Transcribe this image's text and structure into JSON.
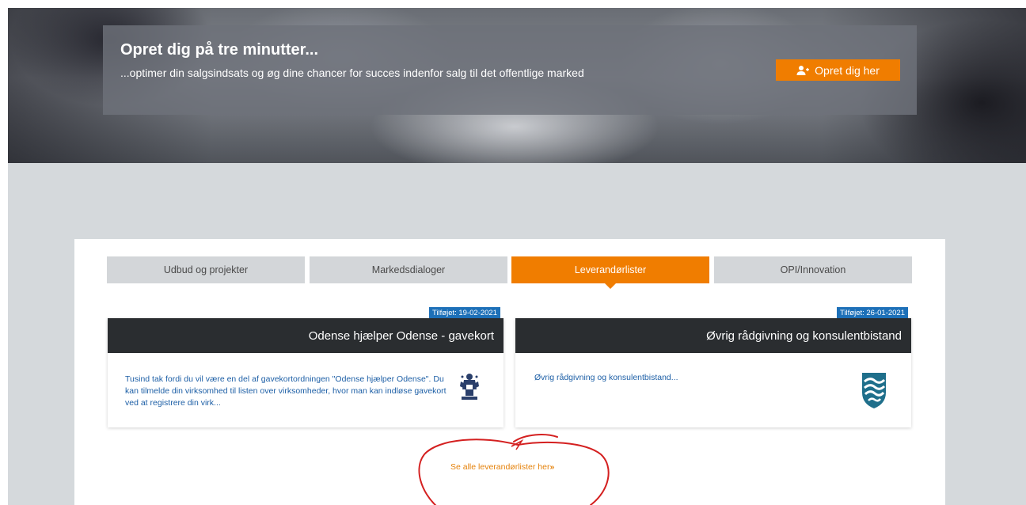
{
  "hero": {
    "title": "Opret dig på tre minutter...",
    "subtitle": "...optimer din salgsindsats og øg dine chancer for succes indenfor salg til det offentlige marked",
    "cta_label": "Opret dig her",
    "cta_icon": "user-plus-icon"
  },
  "tabs": [
    {
      "label": "Udbud og projekter",
      "active": false
    },
    {
      "label": "Markedsdialoger",
      "active": false
    },
    {
      "label": "Leverandørlister",
      "active": true
    },
    {
      "label": "OPI/Innovation",
      "active": false
    }
  ],
  "cards": [
    {
      "badge": "Tilføjet: 19-02-2021",
      "title": "Odense hjælper Odense - gavekort",
      "body": "Tusind tak fordi du vil være en del af gavekortordningen \"Odense hjælper Odense\". Du kan tilmelde din virksomhed til listen over virksomheder, hvor man kan indløse gavekort ved at registrere din virk...",
      "logo_icon": "odense-crest-icon"
    },
    {
      "badge": "Tilføjet: 26-01-2021",
      "title": "Øvrig rådgivning og konsulentbistand",
      "body": "Øvrig rådgivning og konsulentbistand...",
      "logo_icon": "wave-shield-icon"
    }
  ],
  "see_all": {
    "label": "Se alle leverandørlister her",
    "suffix": "»"
  },
  "colors": {
    "accent": "#f07d00",
    "badge": "#1d70b8",
    "card_header": "#2a2d30",
    "link": "#1d5fa6",
    "annotation": "#d42020"
  }
}
